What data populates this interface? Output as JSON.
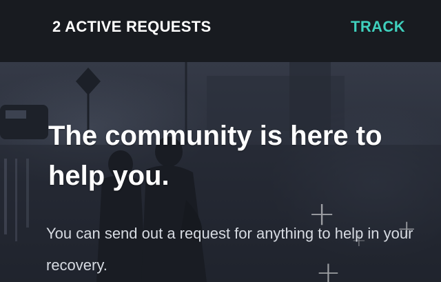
{
  "header": {
    "active_requests": "2 ACTIVE REQUESTS",
    "track_label": "TRACK"
  },
  "hero": {
    "headline": "The community is here to help you.",
    "subtext": "You can send out a request for anything to help in your recovery.",
    "background_image": "flooded-street-photo",
    "decoration_icon": "plus-icon"
  },
  "colors": {
    "header_bg": "#181b20",
    "accent": "#3fd0bd",
    "text": "#ffffff",
    "subtext": "#d7dbe2"
  }
}
